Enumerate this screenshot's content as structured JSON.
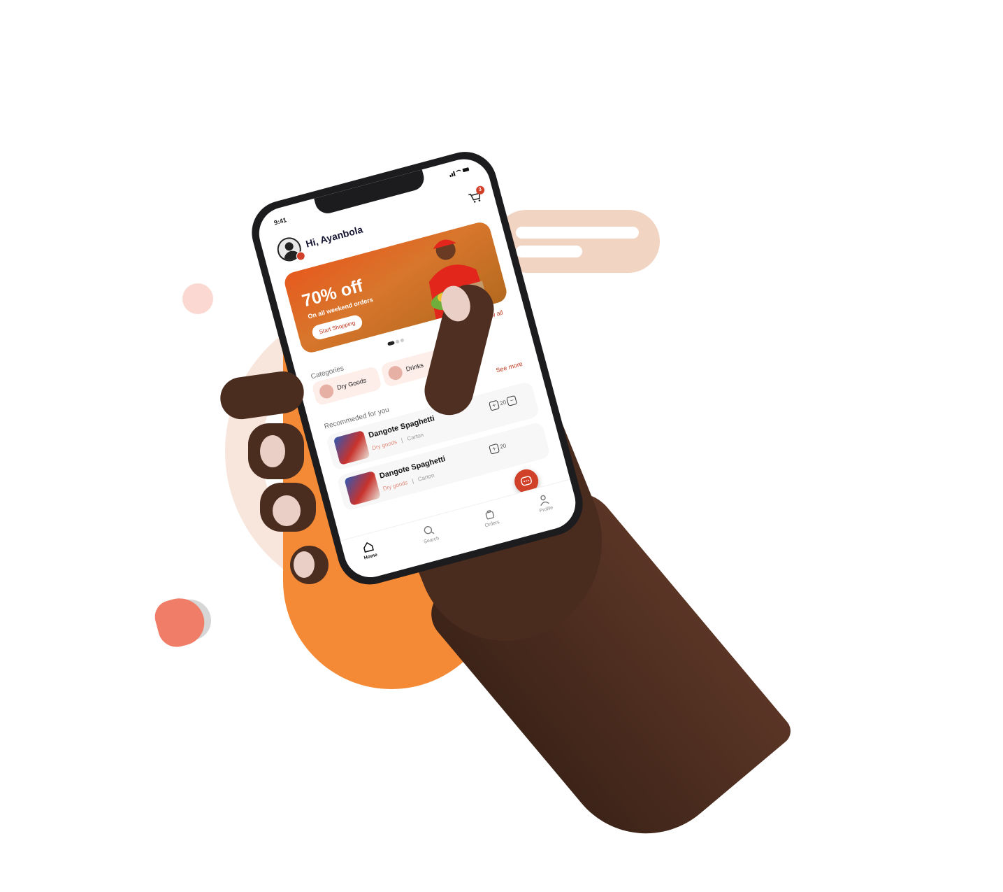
{
  "status_bar": {
    "time": "9:41"
  },
  "header": {
    "greeting": "Hi, Ayanbola",
    "cart_count": "3"
  },
  "banner": {
    "title": "70% off",
    "subtitle": "On all weekend orders",
    "cta": "Start Shopping"
  },
  "categories": {
    "title": "Categories",
    "view_all": "View all",
    "items": [
      {
        "label": "Dry Goods"
      },
      {
        "label": "Drinks"
      }
    ]
  },
  "recommended": {
    "title": "Recommeded for you",
    "see_more": "See more",
    "products": [
      {
        "name": "Dangote Spaghetti",
        "category": "Dry goods",
        "unit": "Carton",
        "qty": "20"
      },
      {
        "name": "Dangote Spaghetti",
        "category": "Dry goods",
        "unit": "Carton",
        "qty": "20"
      }
    ]
  },
  "tabs": [
    {
      "label": "Home",
      "icon": "home-icon"
    },
    {
      "label": "Search",
      "icon": "search-icon"
    },
    {
      "label": "Orders",
      "icon": "bag-icon"
    },
    {
      "label": "Profile",
      "icon": "user-icon"
    }
  ],
  "colors": {
    "accent": "#d1412a",
    "orange": "#f48a36"
  }
}
